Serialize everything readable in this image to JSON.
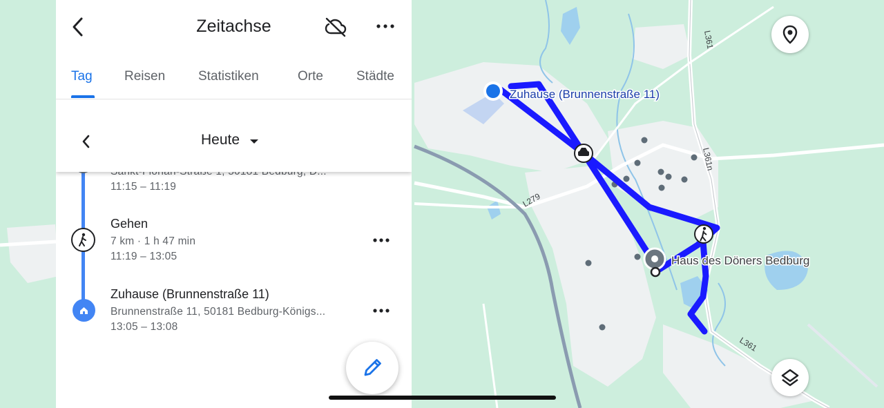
{
  "header": {
    "title": "Zeitachse"
  },
  "tabs": [
    {
      "label": "Tag",
      "active": true
    },
    {
      "label": "Reisen",
      "active": false
    },
    {
      "label": "Statistiken",
      "active": false
    },
    {
      "label": "Orte",
      "active": false
    },
    {
      "label": "Städte",
      "active": false
    }
  ],
  "date_selector": {
    "label": "Heute"
  },
  "timeline": {
    "partial_place": {
      "address": "Sankt-Florian-Straße 1, 50181 Bedburg, D...",
      "time": "11:15 – 11:19"
    },
    "activity": {
      "title": "Gehen",
      "details": "7 km · 1 h 47 min",
      "time": "11:19 – 13:05"
    },
    "place": {
      "title": "Zuhause (Brunnenstraße 11)",
      "address": "Brunnenstraße 11, 50181 Bedburg-Königs...",
      "time": "13:05 – 13:08"
    }
  },
  "map": {
    "labels": {
      "home": "Zuhause (Brunnenstraße 11)",
      "restaurant": "Haus des Döners Bedburg",
      "road_l279": "L279",
      "road_l361_top": "L361",
      "road_l361n": "L361n",
      "road_l361_bottom": "L361"
    }
  },
  "colors": {
    "accent": "#1a73e8",
    "route": "#1a1aff",
    "map_land": "#cdeedd",
    "map_urban": "#f1f3f4"
  },
  "icons": {
    "back": "chevron-left-icon",
    "cloud_off": "cloud-off-icon",
    "more": "more-horizontal-icon",
    "walk": "walking-icon",
    "home": "home-icon",
    "edit": "pencil-icon",
    "location": "location-pin-icon",
    "layers": "layers-icon",
    "car": "car-icon"
  }
}
